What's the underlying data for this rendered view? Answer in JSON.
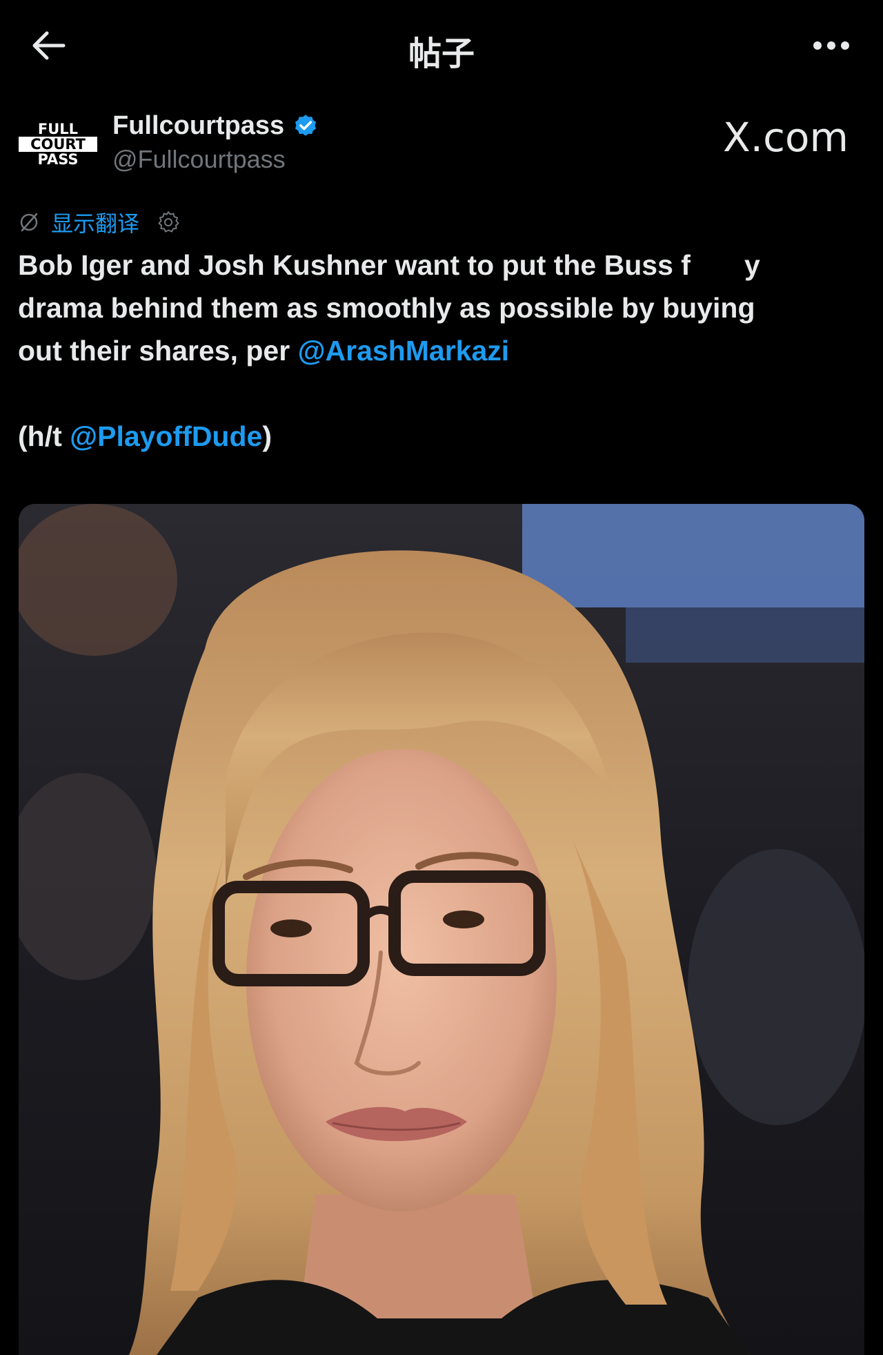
{
  "header": {
    "title": "帖子",
    "back_icon": "arrow-left-icon",
    "more_icon": "more-horizontal-icon"
  },
  "author": {
    "name": "Fullcourtpass",
    "handle": "@Fullcourtpass",
    "verified": true,
    "avatar_logo": {
      "line1": "FULL",
      "line2": "COURT",
      "line3": "PASS"
    }
  },
  "source_watermark": "X.com",
  "translate": {
    "label": "显示翻译",
    "left_icon": "translate-off-icon",
    "right_icon": "gear-icon"
  },
  "post": {
    "line1": "Bob Iger and Josh Kushner want to put the Buss f",
    "line1_tail": "y",
    "line2": "drama behind them as smoothly as possible by buying",
    "line3_text": "out their shares, per ",
    "line3_mention": "@ArashMarkazi",
    "line4_prefix": "(h/t ",
    "line4_mention": "@PlayoffDude",
    "line4_suffix": ")"
  },
  "colors": {
    "background": "#000000",
    "text": "#e7e9ea",
    "secondary": "#71767b",
    "link": "#1d9bf0",
    "verified_badge": "#1d9bf0"
  }
}
